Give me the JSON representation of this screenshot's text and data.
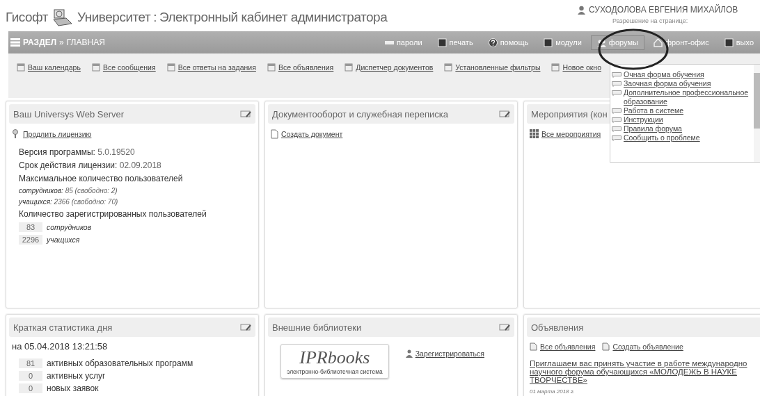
{
  "header": {
    "brand": "Гисофт",
    "product": "Университет",
    "separator": ":",
    "title": "Электронный кабинет администратора",
    "user_name": "СУХОДОЛОВА ЕВГЕНИЯ МИХАЙЛОВ",
    "permission": "Разрешение на странице:"
  },
  "nav": {
    "section": "РАЗДЕЛ",
    "arrow": "»",
    "current": "ГЛАВНАЯ",
    "items": [
      {
        "label": "пароли",
        "selected": false
      },
      {
        "label": "печать",
        "selected": false
      },
      {
        "label": "помощь",
        "selected": false
      },
      {
        "label": "модули",
        "selected": false
      },
      {
        "label": "форумы",
        "selected": true
      },
      {
        "label": "фронт-офис",
        "selected": false
      },
      {
        "label": "выхо",
        "selected": false
      }
    ]
  },
  "toolbar": [
    "Ваш календарь",
    "Все сообщения",
    "Все ответы на задания",
    "Все объявления",
    "Диспетчер документов",
    "Установленные фильтры",
    "Новое окно"
  ],
  "forum_menu": [
    "Очная форма обучения",
    "Заочная форма обучения",
    "Дополнительное профессиональное образование",
    "Работа в системе",
    "Инструкции",
    "Правила форума",
    "Сообщить о проблеме"
  ],
  "server_panel": {
    "title": "Ваш Universys Web Server",
    "link": "Продлить лицензию",
    "version_label": "Версия программы:",
    "version": "5.0.19520",
    "license_label": "Срок действия лицензии:",
    "license": "02.09.2018",
    "max_label": "Максимальное количество пользователей",
    "max_rows": [
      {
        "label": "сотрудников:",
        "value": "85 (свободно: 2)"
      },
      {
        "label": "учащихся:",
        "value": "2366 (свободно: 70)"
      }
    ],
    "reg_label": "Количество зарегистрированных пользователей",
    "reg_rows": [
      {
        "count": "83",
        "label": "сотрудников"
      },
      {
        "count": "2296",
        "label": "учащихся"
      }
    ]
  },
  "docs_panel": {
    "title": "Документооборот и служебная переписка",
    "link": "Создать документ"
  },
  "events_panel": {
    "title": "Мероприятия (кон",
    "link": "Все мероприятия"
  },
  "stats_panel": {
    "title": "Краткая статистика дня",
    "date": "на 05.04.2018 13:21:58",
    "rows": [
      {
        "count": "81",
        "label": "активных образовательных программ"
      },
      {
        "count": "0",
        "label": "активных услуг"
      },
      {
        "count": "0",
        "label": "новых заявок"
      }
    ]
  },
  "libs_panel": {
    "title": "Внешние библиотеки",
    "logo_name": "IPRbooks",
    "logo_caption": "электронно-библиотечная система",
    "link": "Зарегистрироваться"
  },
  "ads_panel": {
    "title": "Объявления",
    "links": [
      "Все объявления",
      "Создать объявление"
    ],
    "news_lines": [
      "Приглашаем вас принять участие в работе международно",
      "научного форума обучающихся «МОЛОДЕЖЬ В НАУКЕ",
      "ТВОРЧЕСТВЕ»"
    ],
    "news_date": "01 марта 2018 г."
  }
}
